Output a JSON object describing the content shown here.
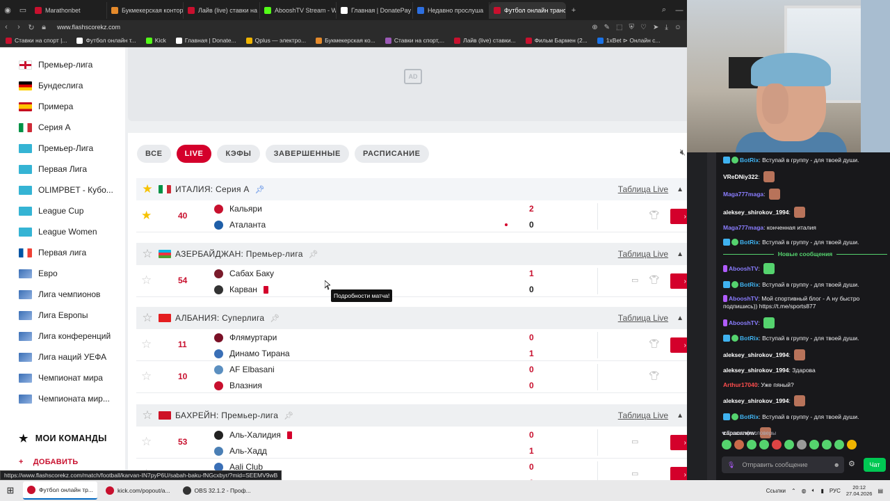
{
  "browser": {
    "tabs": [
      {
        "label": "Marathonbet",
        "color": "#c8102e"
      },
      {
        "label": "Букмекерская контора",
        "color": "#e58a2b"
      },
      {
        "label": "Лайв (live) ставки на Х",
        "color": "#c8102e"
      },
      {
        "label": "AbooshTV Stream - Wat",
        "color": "#53fc18"
      },
      {
        "label": "Главная | DonatePay",
        "color": "#ffffff"
      },
      {
        "label": "Недавно прослуша",
        "color": "#2d6fe0"
      },
      {
        "label": "Футбол онлайн трансля",
        "color": "#c8102e"
      }
    ],
    "url": "www.flashscorekz.com",
    "bookmarks": [
      {
        "label": "Ставки на спорт |...",
        "color": "#c8102e"
      },
      {
        "label": "Футбол онлайн т...",
        "color": "#ffffff"
      },
      {
        "label": "Kick",
        "color": "#53fc18"
      },
      {
        "label": "Главная | Donate...",
        "color": "#ffffff"
      },
      {
        "label": "Qplus — электро...",
        "color": "#f0b400"
      },
      {
        "label": "Букмекерская ко...",
        "color": "#e58a2b"
      },
      {
        "label": "Ставки на спорт,...",
        "color": "#9b59b6"
      },
      {
        "label": "Лайв (live) ставки...",
        "color": "#c8102e"
      },
      {
        "label": "Фильм Бармен (2...",
        "color": "#c8102e"
      },
      {
        "label": "1xBet ⊳ Онлайн с...",
        "color": "#1a73e8"
      }
    ],
    "status_url": "https://www.flashscorekz.com/match/football/karvan-IN7pyP6U/sabah-baku-fNGcxbyr/?mid=SEEMV9wB"
  },
  "sidebar": {
    "leagues": [
      {
        "label": "Премьер-лига",
        "flag": "eng"
      },
      {
        "label": "Бундеслига",
        "flag": "ger"
      },
      {
        "label": "Примера",
        "flag": "esp"
      },
      {
        "label": "Серия А",
        "flag": "ita"
      },
      {
        "label": "Премьер-Лига",
        "flag": "kaz"
      },
      {
        "label": "Первая Лига",
        "flag": "kaz"
      },
      {
        "label": "OLIMPBET - Кубо...",
        "flag": "kaz"
      },
      {
        "label": "League Cup",
        "flag": "kaz"
      },
      {
        "label": "League Women",
        "flag": "kaz"
      },
      {
        "label": "Первая лига",
        "flag": "fra"
      },
      {
        "label": "Евро",
        "flag": "wld"
      },
      {
        "label": "Лига чемпионов",
        "flag": "wld"
      },
      {
        "label": "Лига Европы",
        "flag": "wld"
      },
      {
        "label": "Лига конференций",
        "flag": "wld"
      },
      {
        "label": "Лига наций УЕФА",
        "flag": "wld"
      },
      {
        "label": "Чемпионат мира",
        "flag": "wld"
      },
      {
        "label": "Чемпионата мир...",
        "flag": "wld"
      }
    ],
    "my_teams": "МОИ КОМАНДЫ",
    "add": "ДОБАВИТЬ"
  },
  "ad_label": "AD",
  "filters": {
    "all": "ВСЕ",
    "live": "LIVE",
    "odds": "КЭФЫ",
    "finished": "ЗАВЕРШЕННЫЕ",
    "schedule": "РАСПИСАНИЕ"
  },
  "table_link": "Таблица Live",
  "tooltip": "Подробности матча!",
  "leagues": [
    {
      "name": "ИТАЛИЯ: Серия А",
      "favorite": true,
      "pinned": true,
      "matches": [
        {
          "minute": "40",
          "home": "Кальяри",
          "away": "Аталанта",
          "home_score": "2",
          "away_score": "0",
          "favorite": true
        }
      ]
    },
    {
      "name": "АЗЕРБАЙДЖАН: Премьер-лига",
      "favorite": false,
      "pinned": false,
      "matches": [
        {
          "minute": "54",
          "home": "Сабах Баку",
          "away": "Карван",
          "home_score": "1",
          "away_score": "0",
          "favorite": false
        }
      ]
    },
    {
      "name": "АЛБАНИЯ: Суперлига",
      "favorite": false,
      "pinned": false,
      "matches": [
        {
          "minute": "11",
          "home": "Флямуртари",
          "away": "Динамо Тирана",
          "home_score": "0",
          "away_score": "1",
          "favorite": false
        },
        {
          "minute": "10",
          "home": "AF Elbasani",
          "away": "Влазния",
          "home_score": "0",
          "away_score": "0",
          "favorite": false
        }
      ]
    },
    {
      "name": "БАХРЕЙН: Премьер-лига",
      "favorite": false,
      "pinned": false,
      "matches": [
        {
          "minute": "53",
          "home": "Аль-Халидия",
          "away": "Аль-Хадд",
          "home_score": "0",
          "away_score": "1",
          "favorite": false
        },
        {
          "minute": "",
          "home": "Aali Club",
          "away": "",
          "home_score": "0",
          "away_score": "0",
          "favorite": false
        }
      ]
    }
  ],
  "chat": {
    "messages": [
      {
        "user": "BotRix",
        "color": "#3fb2f0",
        "text": "Вступай в группу - для твоей души."
      },
      {
        "user": "VReDNiy322",
        "color": "#ffffff",
        "text": ""
      },
      {
        "user": "Maga777maga",
        "color": "#8a7dff",
        "text": ""
      },
      {
        "user": "aleksey_shirokov_1994",
        "color": "#ffffff",
        "text": ""
      },
      {
        "user": "Maga777maga",
        "color": "#8a7dff",
        "text": "конченная италия"
      },
      {
        "user": "BotRix",
        "color": "#3fb2f0",
        "text": "Вступай в группу - для твоей души."
      }
    ],
    "new_messages": "Новые сообщения",
    "messages2": [
      {
        "user": "AbooshTV",
        "color": "#8a7dff",
        "text": ""
      },
      {
        "user": "BotRix",
        "color": "#3fb2f0",
        "text": "Вступай в группу - для твоей души."
      },
      {
        "user": "AbooshTV",
        "color": "#8a7dff",
        "text": "Мой спортивный блог - А ну быстро подпишись)) https://t.me/sports877"
      },
      {
        "user": "AbooshTV",
        "color": "#8a7dff",
        "text": ""
      },
      {
        "user": "BotRix",
        "color": "#3fb2f0",
        "text": "Вступай в группу - для твоей души."
      },
      {
        "user": "aleksey_shirokov_1994",
        "color": "#ffffff",
        "text": ""
      },
      {
        "user": "aleksey_shirokov_1994",
        "color": "#ffffff",
        "text": "Здарова"
      },
      {
        "user": "Arthur17040",
        "color": "#ff4d4d",
        "text": "Уже пяный?"
      },
      {
        "user": "aleksey_shirokov_1994",
        "color": "#ffffff",
        "text": ""
      },
      {
        "user": "BotRix",
        "color": "#3fb2f0",
        "text": "Вступай в группу - для твоей души."
      },
      {
        "user": "zapacanow",
        "color": "#ffffff",
        "text": ""
      }
    ],
    "followers_only": "Только фолловеры",
    "input_placeholder": "Отправить сообщение",
    "send": "Чат"
  },
  "taskbar": {
    "items": [
      {
        "label": "Футбол онлайн тр...",
        "color": "#c8102e"
      },
      {
        "label": "kick.com/popout/a...",
        "color": "#c8102e"
      },
      {
        "label": "OBS 32.1.2 - Проф...",
        "color": "#333333"
      }
    ],
    "links": "Ссылки",
    "lang": "РУС",
    "time": "20:12",
    "date": "27.04.2026"
  }
}
